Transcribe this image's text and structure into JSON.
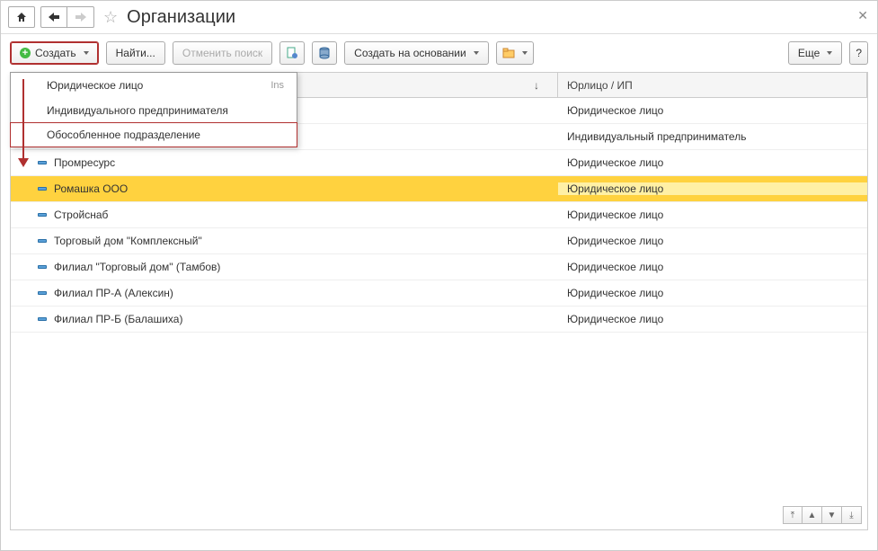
{
  "header": {
    "title": "Организации"
  },
  "toolbar": {
    "create_label": "Создать",
    "find_label": "Найти...",
    "cancel_search_label": "Отменить поиск",
    "create_based_label": "Создать на основании",
    "more_label": "Еще",
    "help_label": "?"
  },
  "create_menu": {
    "items": [
      {
        "label": "Юридическое лицо",
        "shortcut": "Ins"
      },
      {
        "label": "Индивидуального предпринимателя",
        "shortcut": ""
      },
      {
        "label": "Обособленное подразделение",
        "shortcut": ""
      }
    ]
  },
  "table": {
    "columns": {
      "name_sort": "↓",
      "type": "Юрлицо / ИП"
    },
    "rows": [
      {
        "name": "Промресурс",
        "type": "Юридическое лицо",
        "selected": false
      },
      {
        "name": "Ромашка ООО",
        "type": "Юридическое лицо",
        "selected": true
      },
      {
        "name": "Стройснаб",
        "type": "Юридическое лицо",
        "selected": false
      },
      {
        "name": "Торговый дом \"Комплексный\"",
        "type": "Юридическое лицо",
        "selected": false
      },
      {
        "name": "Филиал \"Торговый дом\" (Тамбов)",
        "type": "Юридическое лицо",
        "selected": false
      },
      {
        "name": "Филиал ПР-А (Алексин)",
        "type": "Юридическое лицо",
        "selected": false
      },
      {
        "name": "Филиал ПР-Б (Балашиха)",
        "type": "Юридическое лицо",
        "selected": false
      }
    ],
    "hidden_rows": [
      {
        "type": "Юридическое лицо"
      },
      {
        "type": "Индивидуальный предприниматель"
      }
    ]
  }
}
